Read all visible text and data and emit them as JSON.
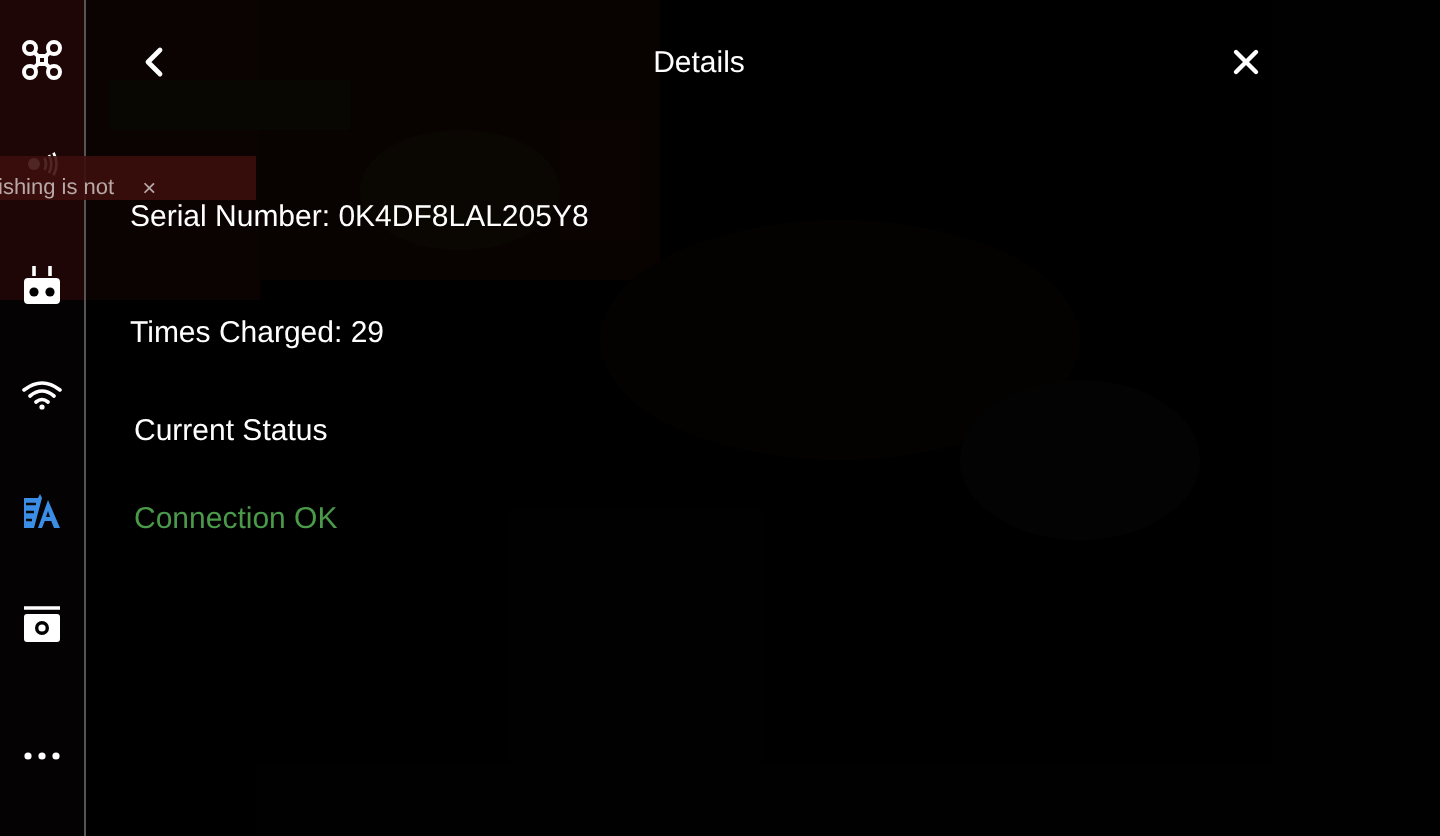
{
  "sidebar": {
    "items": [
      {
        "kind": "drone",
        "selected": false
      },
      {
        "kind": "signal",
        "selected": false
      },
      {
        "kind": "controller",
        "selected": false
      },
      {
        "kind": "wifi",
        "selected": false
      },
      {
        "kind": "battery",
        "selected": true
      },
      {
        "kind": "camera",
        "selected": false
      },
      {
        "kind": "more",
        "selected": false
      }
    ]
  },
  "toast": {
    "text": "ishing is not",
    "close": "×"
  },
  "header": {
    "title": "Details"
  },
  "details": [
    {
      "text": "Serial Number: 0K4DF8LAL205Y8"
    },
    {
      "text": "Times Charged: 29"
    }
  ],
  "status": {
    "label": "Current Status",
    "value": "Connection OK"
  }
}
